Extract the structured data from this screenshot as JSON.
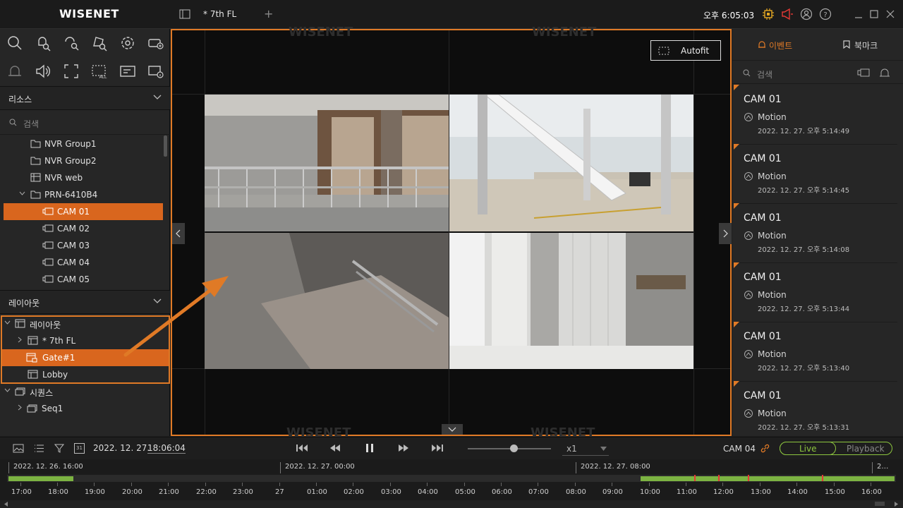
{
  "app": {
    "logo": "WISENET",
    "tab_label": "* 7th FL",
    "tab_add": "+",
    "clock": "오후 6:05:03"
  },
  "resource": {
    "header": "리소스",
    "search_placeholder": "검색",
    "items": [
      {
        "label": "NVR Group1"
      },
      {
        "label": "NVR Group2"
      },
      {
        "label": "NVR web"
      },
      {
        "label": "PRN-6410B4"
      },
      {
        "label": "CAM 01"
      },
      {
        "label": "CAM 02"
      },
      {
        "label": "CAM 03"
      },
      {
        "label": "CAM 04"
      },
      {
        "label": "CAM 05"
      }
    ]
  },
  "layout": {
    "header": "레이아웃",
    "root": "레이아웃",
    "items": [
      {
        "label": "* 7th FL"
      },
      {
        "label": "Gate#1"
      },
      {
        "label": "Lobby"
      }
    ],
    "sequence_root": "시퀀스",
    "sequence_items": [
      {
        "label": "Seq1"
      }
    ]
  },
  "main": {
    "autofit_label": "Autofit",
    "watermark": "WISENET"
  },
  "events": {
    "tab_event": "이벤트",
    "tab_bookmark": "북마크",
    "search_placeholder": "검색",
    "items": [
      {
        "camera": "CAM 01",
        "type": "Motion",
        "time": "2022. 12. 27. 오후 5:14:49"
      },
      {
        "camera": "CAM 01",
        "type": "Motion",
        "time": "2022. 12. 27. 오후 5:14:45"
      },
      {
        "camera": "CAM 01",
        "type": "Motion",
        "time": "2022. 12. 27. 오후 5:14:08"
      },
      {
        "camera": "CAM 01",
        "type": "Motion",
        "time": "2022. 12. 27. 오후 5:13:44"
      },
      {
        "camera": "CAM 01",
        "type": "Motion",
        "time": "2022. 12. 27. 오후 5:13:40"
      },
      {
        "camera": "CAM 01",
        "type": "Motion",
        "time": "2022. 12. 27. 오후 5:13:31"
      }
    ]
  },
  "controls": {
    "calendar_day": "31",
    "date": "2022. 12. 27.",
    "time": "18:06:04",
    "speed": "x1",
    "camera": "CAM 04",
    "live_label": "Live",
    "playback_label": "Playback"
  },
  "timeline": {
    "date_markers": [
      "2022. 12. 26. 16:00",
      "2022. 12. 27. 00:00",
      "2022. 12. 27. 08:00",
      "2…"
    ],
    "hour_labels": [
      "17:00",
      "18:00",
      "19:00",
      "20:00",
      "21:00",
      "22:00",
      "23:00",
      "27",
      "01:00",
      "02:00",
      "03:00",
      "04:00",
      "05:00",
      "06:00",
      "07:00",
      "08:00",
      "09:00",
      "10:00",
      "11:00",
      "12:00",
      "13:00",
      "14:00",
      "15:00",
      "16:00"
    ]
  },
  "colors": {
    "accent": "#e07a26",
    "selected": "#d9661e",
    "live_green": "#8dc63f",
    "recording": "#7cb342",
    "event_mark": "#e53935"
  }
}
